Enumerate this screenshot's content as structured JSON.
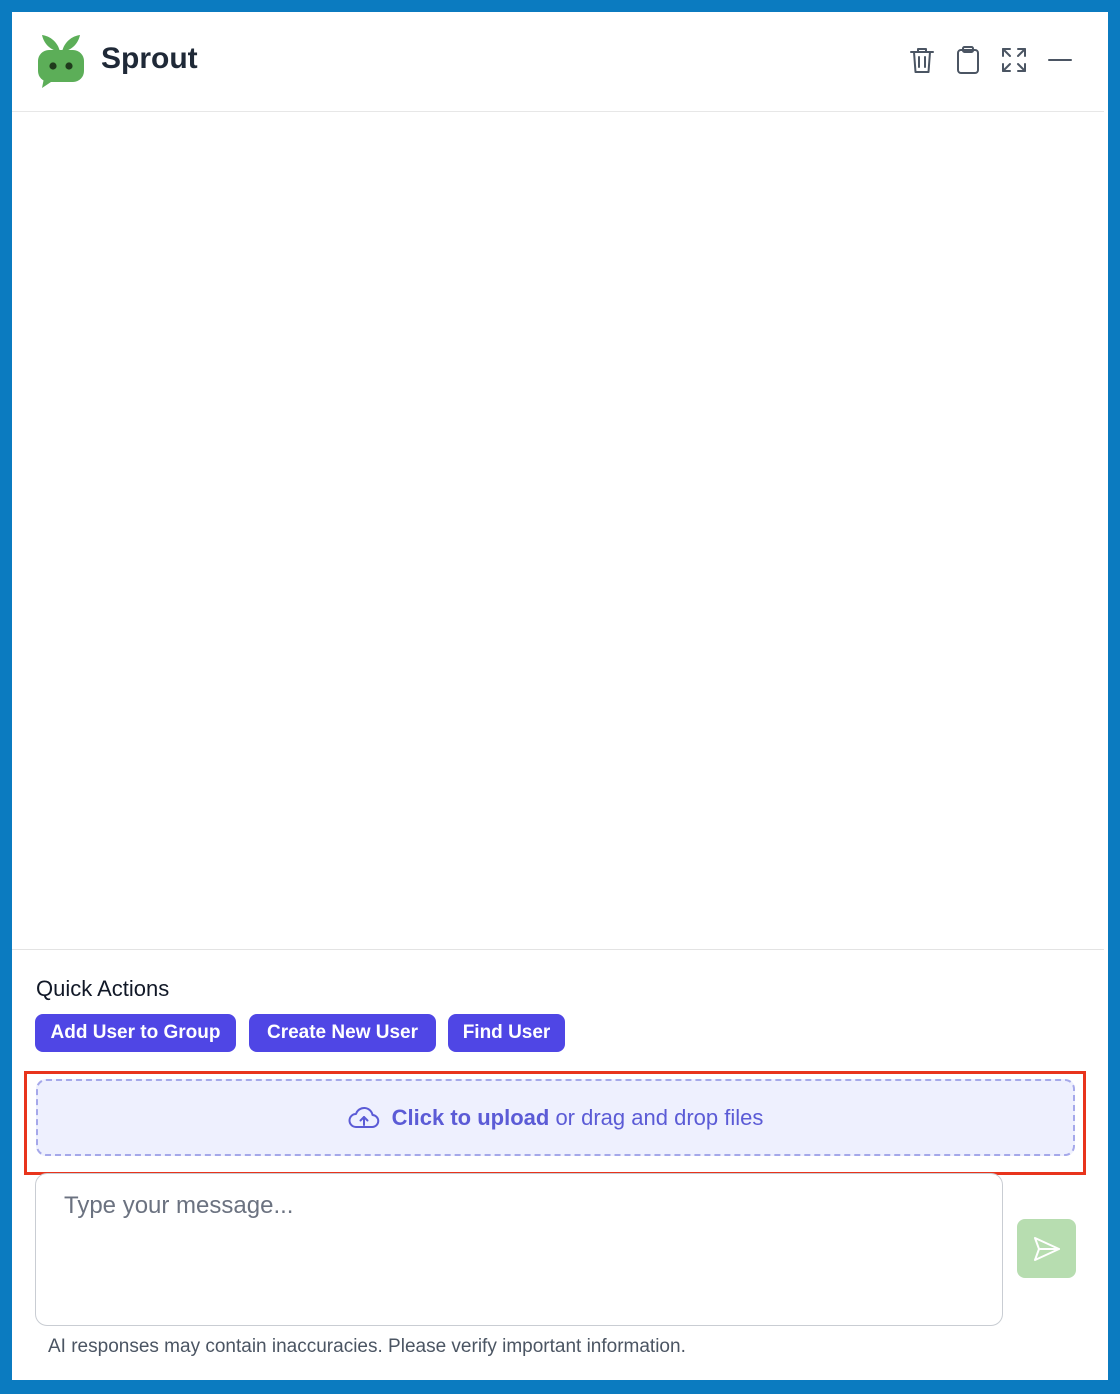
{
  "app": {
    "title": "Sprout",
    "brand_color": "#5cae58",
    "accent_color": "#4f46e5"
  },
  "header": {
    "actions": [
      {
        "name": "clear-chat-button",
        "icon": "trash-icon"
      },
      {
        "name": "copy-button",
        "icon": "clipboard-icon"
      },
      {
        "name": "expand-button",
        "icon": "expand-icon"
      },
      {
        "name": "minimize-button",
        "icon": "minus-icon"
      }
    ]
  },
  "quick_actions": {
    "title": "Quick Actions",
    "buttons": [
      {
        "label": "Add User to Group"
      },
      {
        "label": "Create New User"
      },
      {
        "label": "Find User"
      }
    ]
  },
  "upload": {
    "icon": "cloud-upload-icon",
    "link_text": "Click to upload",
    "rest_text": " or drag and drop files"
  },
  "composer": {
    "placeholder": "Type your message...",
    "value": "",
    "send_icon": "send-icon"
  },
  "footer": {
    "disclaimer": "AI responses may contain inaccuracies. Please verify important information."
  }
}
